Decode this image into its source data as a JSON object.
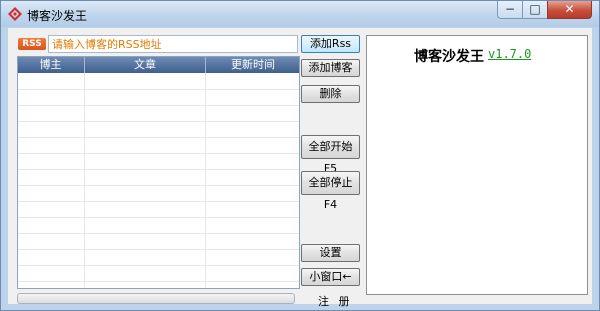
{
  "window": {
    "title": "博客沙发王",
    "controls": {
      "minimize": "−",
      "maximize": "□",
      "close": "✕"
    }
  },
  "rss": {
    "tag": "RSS",
    "placeholder": "请输入博客的RSS地址"
  },
  "table": {
    "columns": [
      "博主",
      "文章",
      "更新时间"
    ],
    "rows": []
  },
  "buttons": {
    "add_rss": "添加Rss",
    "add_blog": "添加博客",
    "delete": "删除",
    "start_all": "全部开始F5",
    "stop_all": "全部停止F4",
    "settings": "设置",
    "mini_window": "小窗口←"
  },
  "register_label": "注 册",
  "panel": {
    "title": "博客沙发王",
    "version": "v1.7.0"
  },
  "colors": {
    "accent_green": "#1a9a1a",
    "rss_orange": "#e07b00",
    "header_blue": "#3e5f8f"
  }
}
